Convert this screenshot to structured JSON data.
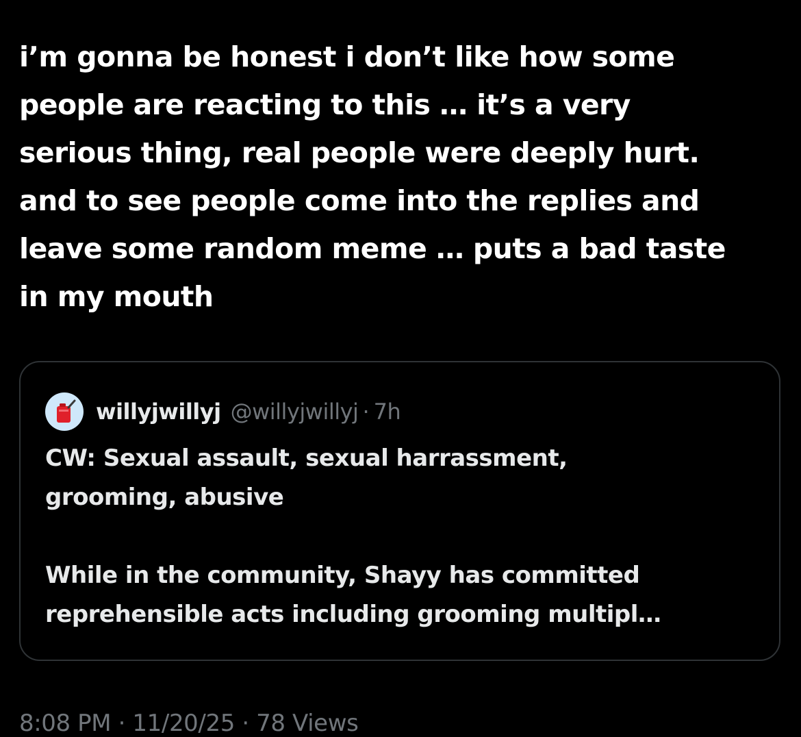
{
  "post": {
    "text": "i’m gonna be honest i don’t like how some\npeople are reacting to this … it’s a very\nserious thing, real people were deeply hurt.\nand to see people come into the replies and\nleave some random meme … puts a bad taste\nin my mouth"
  },
  "quote": {
    "avatar_icon": "gas-can-icon",
    "display_name": "willyjwillyj",
    "handle": "@willyjwillyj",
    "separator": "·",
    "time": "7h",
    "lines": [
      "CW: Sexual assault, sexual harrassment,",
      "grooming, abusive",
      "",
      "While in the community, Shayy has committed",
      "reprehensible acts including grooming multipl…"
    ]
  },
  "meta": {
    "text": "8:08 PM · 11/20/25 · 78 Views"
  },
  "colors": {
    "background": "#000000",
    "primary_text": "#ffffff",
    "secondary_text": "#71767b",
    "border": "#2f3336",
    "avatar_bg": "#cfe8fb",
    "gas_can": "#e0202a"
  }
}
